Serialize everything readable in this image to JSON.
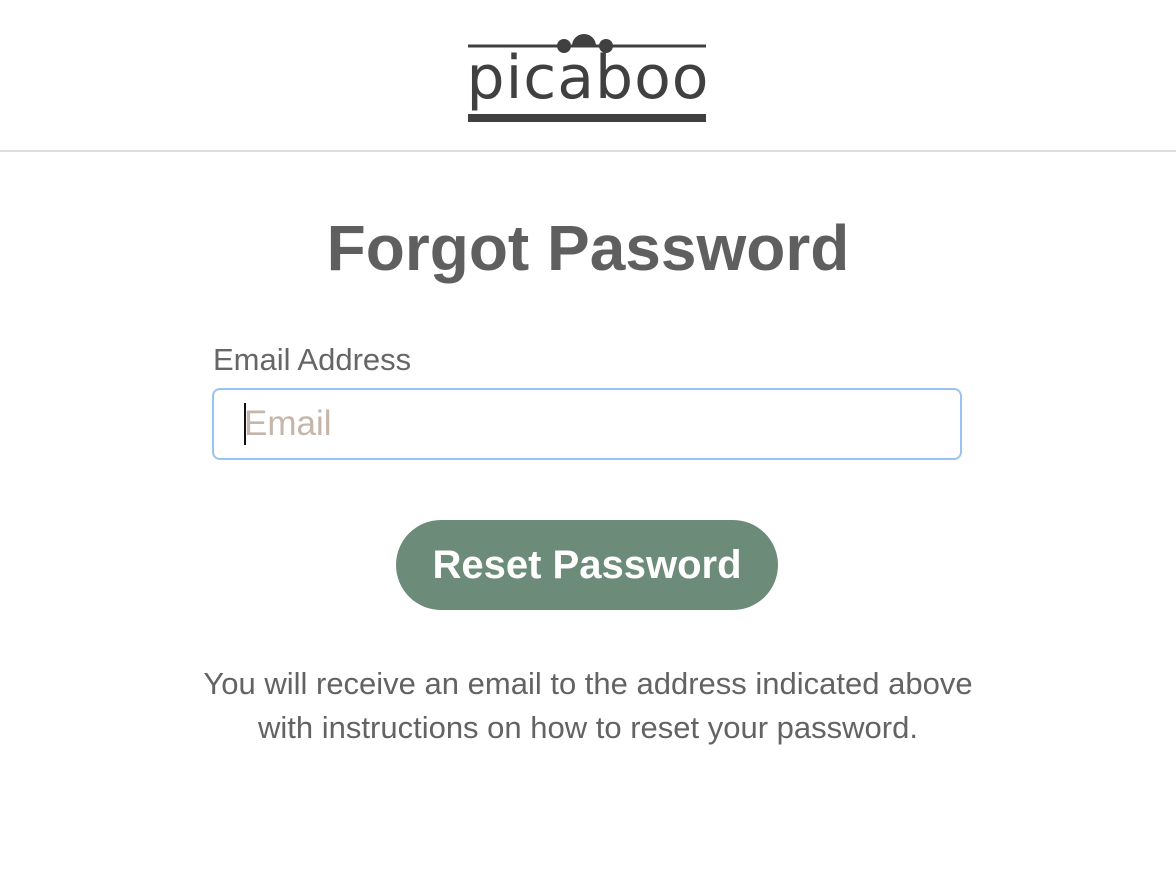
{
  "header": {
    "logo_text": "picaboo",
    "logo_color": "#404040"
  },
  "main": {
    "title": "Forgot Password",
    "email_label": "Email Address",
    "email_value": "",
    "email_placeholder": "Email",
    "reset_button_label": "Reset Password",
    "info_text": "You will receive an email to the address indicated above with instructions on how to reset your password."
  },
  "colors": {
    "button_bg": "#6d8b79",
    "input_focus_border": "#9cc2f2",
    "text": "#636363"
  }
}
